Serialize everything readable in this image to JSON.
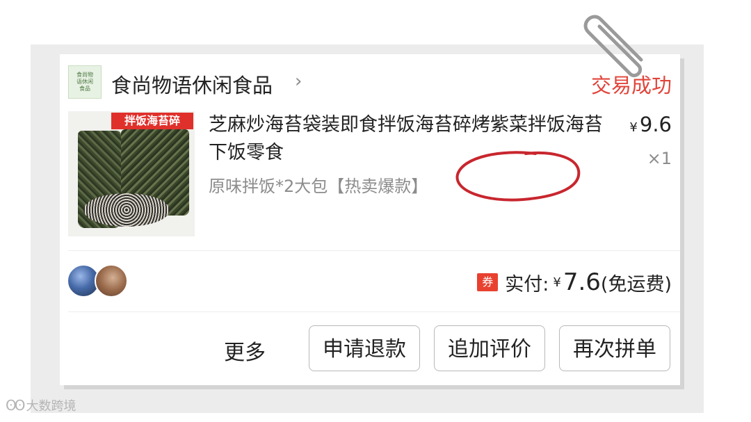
{
  "shop": {
    "logo_text": [
      "食尚物",
      "语休闲",
      "食品"
    ],
    "name": "食尚物语休闲食品",
    "chevron": "›",
    "status": "交易成功"
  },
  "product": {
    "thumbnail_banner": "拌饭海苔碎",
    "title": "芝麻炒海苔袋装即食拌饭海苔碎烤紫菜拌饭海苔下饭零食",
    "spec": "原味拌饭*2大包【热卖爆款】",
    "price_currency": "¥",
    "price": "9.6",
    "quantity": "×1"
  },
  "payment": {
    "coupon_icon": "券",
    "label": "实付:",
    "currency": "¥",
    "amount": "7.6",
    "shipping_note": "(免运费)"
  },
  "actions": {
    "more": "更多",
    "refund": "申请退款",
    "review": "追加评价",
    "reorder": "再次拼单"
  },
  "watermark": {
    "icon": "ʘʘ",
    "text": "大数跨境"
  },
  "colors": {
    "status_red": "#e0443a",
    "circle_red": "#c8262e",
    "coupon_red": "#e8412f"
  },
  "icons": {
    "chevron": "chevron-right-icon",
    "coupon": "coupon-icon",
    "clip": "paperclip-icon",
    "annotation": "hand-drawn-circle"
  }
}
